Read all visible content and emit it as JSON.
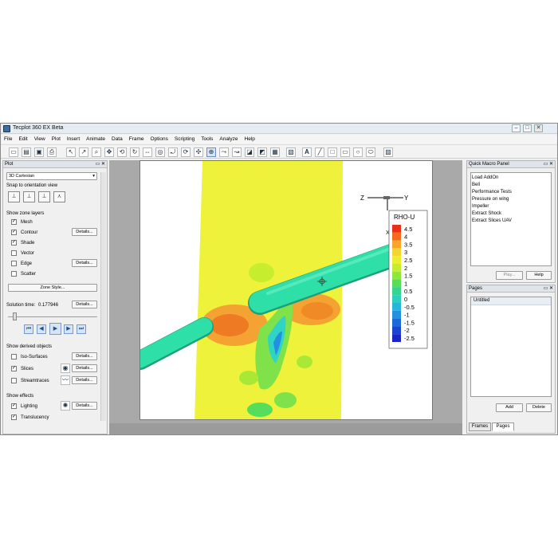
{
  "window": {
    "title": "Tecplot 360 EX Beta"
  },
  "menu": [
    "File",
    "Edit",
    "View",
    "Plot",
    "Insert",
    "Animate",
    "Data",
    "Frame",
    "Options",
    "Scripting",
    "Tools",
    "Analyze",
    "Help"
  ],
  "plot_panel": {
    "title": "Plot",
    "plot_type": "3D Cartesian",
    "snap_label": "Snap to orientation view",
    "zone_layers_label": "Show zone layers",
    "layers": [
      {
        "label": "Mesh",
        "checked": true
      },
      {
        "label": "Contour",
        "checked": true,
        "details": "Details..."
      },
      {
        "label": "Shade",
        "checked": true
      },
      {
        "label": "Vector",
        "checked": false
      },
      {
        "label": "Edge",
        "checked": false,
        "details": "Details..."
      },
      {
        "label": "Scatter",
        "checked": false
      }
    ],
    "zone_style": "Zone Style...",
    "solution_time_label": "Solution time:",
    "solution_time_value": "0.177946",
    "solution_details": "Details...",
    "derived_label": "Show derived objects",
    "derived": [
      {
        "label": "Iso-Surfaces",
        "checked": false,
        "details": "Details..."
      },
      {
        "label": "Slices",
        "checked": true,
        "details": "Details..."
      },
      {
        "label": "Streamtraces",
        "checked": false,
        "details": "Details..."
      }
    ],
    "effects_label": "Show effects",
    "effects": [
      {
        "label": "Lighting",
        "checked": true,
        "details": "Details..."
      },
      {
        "label": "Translucency",
        "checked": true
      }
    ]
  },
  "legend": {
    "title": "RHO-U",
    "levels": [
      "4.5",
      "4",
      "3.5",
      "3",
      "2.5",
      "2",
      "1.5",
      "1",
      "0.5",
      "0",
      "-0.5",
      "-1",
      "-1.5",
      "-2",
      "-2.5"
    ],
    "colors": [
      "#e8301c",
      "#f56a1d",
      "#f7a52c",
      "#f2d531",
      "#e8ef2e",
      "#c3ed2d",
      "#8fe63c",
      "#56de5b",
      "#34d58e",
      "#2bd0bd",
      "#26b6dc",
      "#2390e0",
      "#1e69d8",
      "#1b45cf",
      "#1a25c6"
    ]
  },
  "axes": {
    "z": "Z",
    "y": "Y",
    "x": "X"
  },
  "macro_panel": {
    "title": "Quick Macro Panel",
    "items": [
      "Load AddOn",
      "Bell",
      "Performance Tests",
      "Pressure on wing",
      "Impeller",
      "Extract Shock",
      "Extract Slices UAV"
    ],
    "play": "Play...",
    "help": "Help"
  },
  "pages_panel": {
    "title": "Pages",
    "items": [
      "Untitled"
    ],
    "add": "Add",
    "delete": "Delete",
    "tabs": [
      "Frames",
      "Pages"
    ]
  },
  "colors": {
    "slice_yellow": "#eef23a",
    "pipe": "#2ee0a8"
  }
}
